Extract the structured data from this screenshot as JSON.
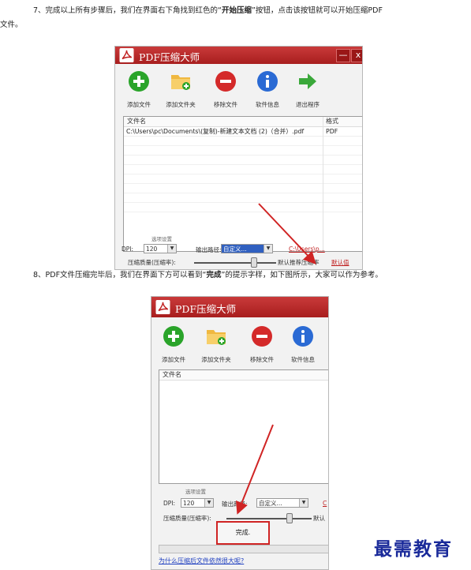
{
  "step7": {
    "line1_prefix": "7、完成以上所有步骤后，我们在界面右下角找到红色的“",
    "line1_bold": "开始压缩",
    "line1_suffix": "”按钮，点击该按钮就可以开始压缩PDF",
    "line2": "文件。"
  },
  "step8": {
    "prefix": "8、PDF文件压缩完毕后，我们在界面下方可以看到“",
    "bold": "完成",
    "suffix": "”的提示字样，如下图所示，大家可以作为参考。"
  },
  "app": {
    "title": "PDF压缩大师",
    "minimize_label": "—",
    "close_label": "x",
    "toolbar": {
      "add_file": "添加文件",
      "add_folder": "添加文件夹",
      "remove_file": "移除文件",
      "software_info": "软件信息",
      "exit": "退出程序"
    },
    "grid": {
      "col_filename": "文件名",
      "col_format": "格式",
      "rows": [
        {
          "filename": "C:\\Users\\pc\\Documents\\(复制)-新建文本文档 (2)（合并）.pdf",
          "format": "PDF"
        }
      ]
    },
    "options": {
      "legend": "选项设置",
      "dpi_label": "DPI:",
      "dpi_value": "120",
      "output_label": "输出路径:",
      "output_value": "自定义...",
      "output_path_1": "C:\\Users\\p...",
      "output_path_2": "C",
      "quality_label": "压缩质量(压缩率):",
      "default_keep_1": "默认推荐压缩率",
      "default_keep_2": "默认",
      "default_value": "默认值"
    },
    "status": {
      "done": "完成.",
      "why_link": "为什么压缩后文件依然很大呢?"
    }
  },
  "watermark": "最需教育",
  "colors": {
    "titlebar": "#b52a2a",
    "annotation_red": "#d02424",
    "watermark_blue": "#1a2a9a"
  }
}
